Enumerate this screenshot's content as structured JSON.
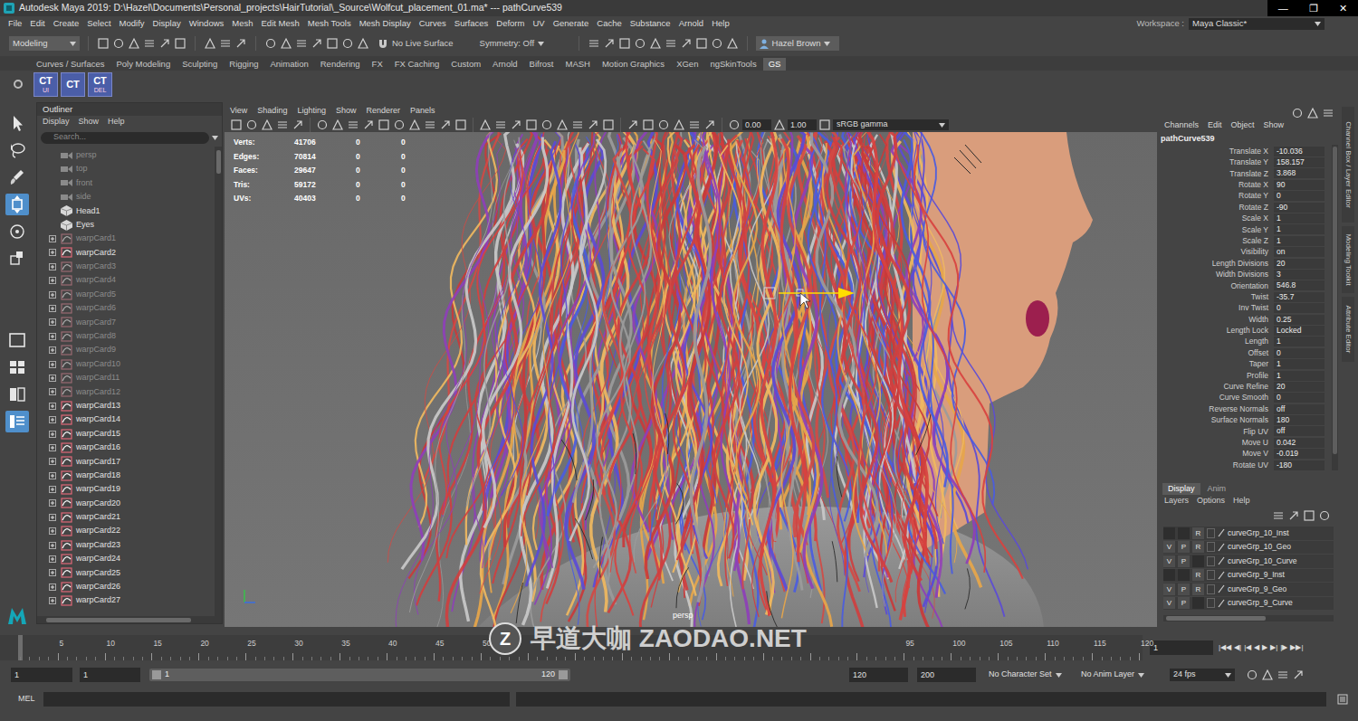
{
  "window": {
    "title": "Autodesk Maya 2019: D:\\Hazel\\Documents\\Personal_projects\\HairTutorial\\_Source\\Wolfcut_placement_01.ma*  ---  pathCurve539",
    "controls": [
      "—",
      "❐",
      "✕"
    ]
  },
  "menu_bar": {
    "items": [
      "File",
      "Edit",
      "Create",
      "Select",
      "Modify",
      "Display",
      "Windows",
      "Mesh",
      "Edit Mesh",
      "Mesh Tools",
      "Mesh Display",
      "Curves",
      "Surfaces",
      "Deform",
      "UV",
      "Generate",
      "Cache",
      "Substance",
      "Arnold",
      "Help"
    ],
    "workspace_label": "Workspace :",
    "workspace": "Maya Classic*"
  },
  "status_line": {
    "mode": "Modeling",
    "live_surface": "No Live Surface",
    "symmetry": "Symmetry: Off",
    "user": "Hazel Brown"
  },
  "shelf": {
    "tabs": [
      {
        "label": "Curves / Surfaces",
        "selected": false
      },
      {
        "label": "Poly Modeling",
        "selected": false
      },
      {
        "label": "Sculpting",
        "selected": false
      },
      {
        "label": "Rigging",
        "selected": false
      },
      {
        "label": "Animation",
        "selected": false
      },
      {
        "label": "Rendering",
        "selected": false
      },
      {
        "label": "FX",
        "selected": false
      },
      {
        "label": "FX Caching",
        "selected": false
      },
      {
        "label": "Custom",
        "selected": false
      },
      {
        "label": "Arnold",
        "selected": false
      },
      {
        "label": "Bifrost",
        "selected": false
      },
      {
        "label": "MASH",
        "selected": false
      },
      {
        "label": "Motion Graphics",
        "selected": false
      },
      {
        "label": "XGen",
        "selected": false
      },
      {
        "label": "ngSkinTools",
        "selected": false
      },
      {
        "label": "GS",
        "selected": true
      }
    ],
    "buttons": [
      {
        "label": "CT",
        "sub": "UI"
      },
      {
        "label": "CT"
      },
      {
        "label": "CT",
        "sub": "DEL"
      }
    ]
  },
  "toolbox": {
    "tools": [
      {
        "kind": "select",
        "selected": false
      },
      {
        "kind": "lasso",
        "selected": false
      },
      {
        "kind": "paint",
        "selected": false
      },
      {
        "kind": "move",
        "selected": true
      },
      {
        "kind": "rotate",
        "selected": false
      },
      {
        "kind": "scale",
        "selected": false
      }
    ],
    "layouts": [
      {
        "kind": "single",
        "selected": false
      },
      {
        "kind": "four",
        "selected": false
      },
      {
        "kind": "two",
        "selected": false
      },
      {
        "kind": "outliner",
        "selected": true
      }
    ]
  },
  "outliner": {
    "title": "Outliner",
    "menu": [
      "Display",
      "Show",
      "Help"
    ],
    "search_placeholder": "Search...",
    "items": [
      {
        "label": "persp",
        "kind": "camera",
        "dimmed": true,
        "expandable": false
      },
      {
        "label": "top",
        "kind": "camera",
        "dimmed": true,
        "expandable": false
      },
      {
        "label": "front",
        "kind": "camera",
        "dimmed": true,
        "expandable": false
      },
      {
        "label": "side",
        "kind": "camera",
        "dimmed": true,
        "expandable": false
      },
      {
        "label": "Head1",
        "kind": "mesh",
        "dimmed": false,
        "expandable": false
      },
      {
        "label": "Eyes",
        "kind": "mesh",
        "dimmed": false,
        "expandable": false
      },
      {
        "label": "warpCard1",
        "kind": "curve",
        "dimmed": true,
        "expandable": true
      },
      {
        "label": "warpCard2",
        "kind": "curve",
        "dimmed": false,
        "expandable": true
      },
      {
        "label": "warpCard3",
        "kind": "curve",
        "dimmed": true,
        "expandable": true
      },
      {
        "label": "warpCard4",
        "kind": "curve",
        "dimmed": true,
        "expandable": true
      },
      {
        "label": "warpCard5",
        "kind": "curve",
        "dimmed": true,
        "expandable": true
      },
      {
        "label": "warpCard6",
        "kind": "curve",
        "dimmed": true,
        "expandable": true
      },
      {
        "label": "warpCard7",
        "kind": "curve",
        "dimmed": true,
        "expandable": true
      },
      {
        "label": "warpCard8",
        "kind": "curve",
        "dimmed": true,
        "expandable": true
      },
      {
        "label": "warpCard9",
        "kind": "curve",
        "dimmed": true,
        "expandable": true
      },
      {
        "label": "warpCard10",
        "kind": "curve",
        "dimmed": true,
        "expandable": true
      },
      {
        "label": "warpCard11",
        "kind": "curve",
        "dimmed": true,
        "expandable": true
      },
      {
        "label": "warpCard12",
        "kind": "curve",
        "dimmed": true,
        "expandable": true
      },
      {
        "label": "warpCard13",
        "kind": "curve",
        "dimmed": false,
        "expandable": true
      },
      {
        "label": "warpCard14",
        "kind": "curve",
        "dimmed": false,
        "expandable": true
      },
      {
        "label": "warpCard15",
        "kind": "curve",
        "dimmed": false,
        "expandable": true
      },
      {
        "label": "warpCard16",
        "kind": "curve",
        "dimmed": false,
        "expandable": true
      },
      {
        "label": "warpCard17",
        "kind": "curve",
        "dimmed": false,
        "expandable": true
      },
      {
        "label": "warpCard18",
        "kind": "curve",
        "dimmed": false,
        "expandable": true
      },
      {
        "label": "warpCard19",
        "kind": "curve",
        "dimmed": false,
        "expandable": true
      },
      {
        "label": "warpCard20",
        "kind": "curve",
        "dimmed": false,
        "expandable": true
      },
      {
        "label": "warpCard21",
        "kind": "curve",
        "dimmed": false,
        "expandable": true
      },
      {
        "label": "warpCard22",
        "kind": "curve",
        "dimmed": false,
        "expandable": true
      },
      {
        "label": "warpCard23",
        "kind": "curve",
        "dimmed": false,
        "expandable": true
      },
      {
        "label": "warpCard24",
        "kind": "curve",
        "dimmed": false,
        "expandable": true
      },
      {
        "label": "warpCard25",
        "kind": "curve",
        "dimmed": false,
        "expandable": true
      },
      {
        "label": "warpCard26",
        "kind": "curve",
        "dimmed": false,
        "expandable": true
      },
      {
        "label": "warpCard27",
        "kind": "curve",
        "dimmed": false,
        "expandable": true
      }
    ]
  },
  "viewport": {
    "menu": [
      "View",
      "Shading",
      "Lighting",
      "Show",
      "Renderer",
      "Panels"
    ],
    "exposure": "0.00",
    "gamma": "1.00",
    "color_space": "sRGB gamma",
    "hud": [
      {
        "label": "Verts:",
        "values": [
          "41706",
          "0",
          "0"
        ]
      },
      {
        "label": "Edges:",
        "values": [
          "70814",
          "0",
          "0"
        ]
      },
      {
        "label": "Faces:",
        "values": [
          "29647",
          "0",
          "0"
        ]
      },
      {
        "label": "Tris:",
        "values": [
          "59172",
          "0",
          "0"
        ]
      },
      {
        "label": "UVs:",
        "values": [
          "40403",
          "0",
          "0"
        ]
      }
    ],
    "camera": "persp"
  },
  "channel_box": {
    "menu": [
      "Channels",
      "Edit",
      "Object",
      "Show"
    ],
    "object": "pathCurve539",
    "attributes": [
      {
        "name": "Translate X",
        "value": "-10.036"
      },
      {
        "name": "Translate Y",
        "value": "158.157"
      },
      {
        "name": "Translate Z",
        "value": "3.868"
      },
      {
        "name": "Rotate X",
        "value": "90"
      },
      {
        "name": "Rotate Y",
        "value": "0"
      },
      {
        "name": "Rotate Z",
        "value": "-90"
      },
      {
        "name": "Scale X",
        "value": "1"
      },
      {
        "name": "Scale Y",
        "value": "1"
      },
      {
        "name": "Scale Z",
        "value": "1"
      },
      {
        "name": "Visibility",
        "value": "on"
      },
      {
        "name": "Length Divisions",
        "value": "20"
      },
      {
        "name": "Width Divisions",
        "value": "3"
      },
      {
        "name": "Orientation",
        "value": "546.8"
      },
      {
        "name": "Twist",
        "value": "-35.7"
      },
      {
        "name": "Inv Twist",
        "value": "0"
      },
      {
        "name": "Width",
        "value": "0.25"
      },
      {
        "name": "Length Lock",
        "value": "Locked"
      },
      {
        "name": "Length",
        "value": "1"
      },
      {
        "name": "Offset",
        "value": "0"
      },
      {
        "name": "Taper",
        "value": "1"
      },
      {
        "name": "Profile",
        "value": "1"
      },
      {
        "name": "Curve Refine",
        "value": "20"
      },
      {
        "name": "Curve Smooth",
        "value": "0"
      },
      {
        "name": "Reverse Normals",
        "value": "off"
      },
      {
        "name": "Surface Normals",
        "value": "180"
      },
      {
        "name": "Flip UV",
        "value": "off"
      },
      {
        "name": "Move U",
        "value": "0.042"
      },
      {
        "name": "Move V",
        "value": "-0.019"
      },
      {
        "name": "Rotate UV",
        "value": "-180"
      }
    ]
  },
  "layer_editor": {
    "tabs": [
      {
        "label": "Display",
        "selected": true
      },
      {
        "label": "Anim",
        "selected": false
      }
    ],
    "menu": [
      "Layers",
      "Options",
      "Help"
    ],
    "flag_labels": [
      "V",
      "P",
      "R"
    ],
    "layers": [
      {
        "name": "curveGrp_10_Inst",
        "visible": false,
        "playback": false,
        "reference": true
      },
      {
        "name": "curveGrp_10_Geo",
        "visible": true,
        "playback": true,
        "reference": true
      },
      {
        "name": "curveGrp_10_Curve",
        "visible": true,
        "playback": true,
        "reference": false
      },
      {
        "name": "curveGrp_9_Inst",
        "visible": false,
        "playback": false,
        "reference": true
      },
      {
        "name": "curveGrp_9_Geo",
        "visible": true,
        "playback": true,
        "reference": true
      },
      {
        "name": "curveGrp_9_Curve",
        "visible": true,
        "playback": true,
        "reference": false
      }
    ]
  },
  "side_tabs": [
    "Channel Box / Layer Editor",
    "Modeling Toolkit",
    "Attribute Editor"
  ],
  "timeline": {
    "ticks": [
      "5",
      "10",
      "15",
      "20",
      "25",
      "30",
      "35",
      "40",
      "45",
      "50",
      "95",
      "100",
      "105",
      "110",
      "115",
      "120"
    ],
    "current_frame": "1",
    "playback_controls": [
      "|◀◀",
      "◀|",
      "|◀",
      "◀",
      "▶",
      "▶|",
      "|▶",
      "▶▶|"
    ]
  },
  "range": {
    "start": "1",
    "playback_start": "1",
    "slider_start": "1",
    "slider_end": "120",
    "playback_end": "120",
    "end": "200",
    "character_set": "No Character Set",
    "anim_layer": "No Anim Layer",
    "fps": "24 fps"
  },
  "command_line": {
    "language": "MEL"
  },
  "watermark": {
    "logo": "Z",
    "text": "早道大咖 ZAODAO.NET"
  }
}
